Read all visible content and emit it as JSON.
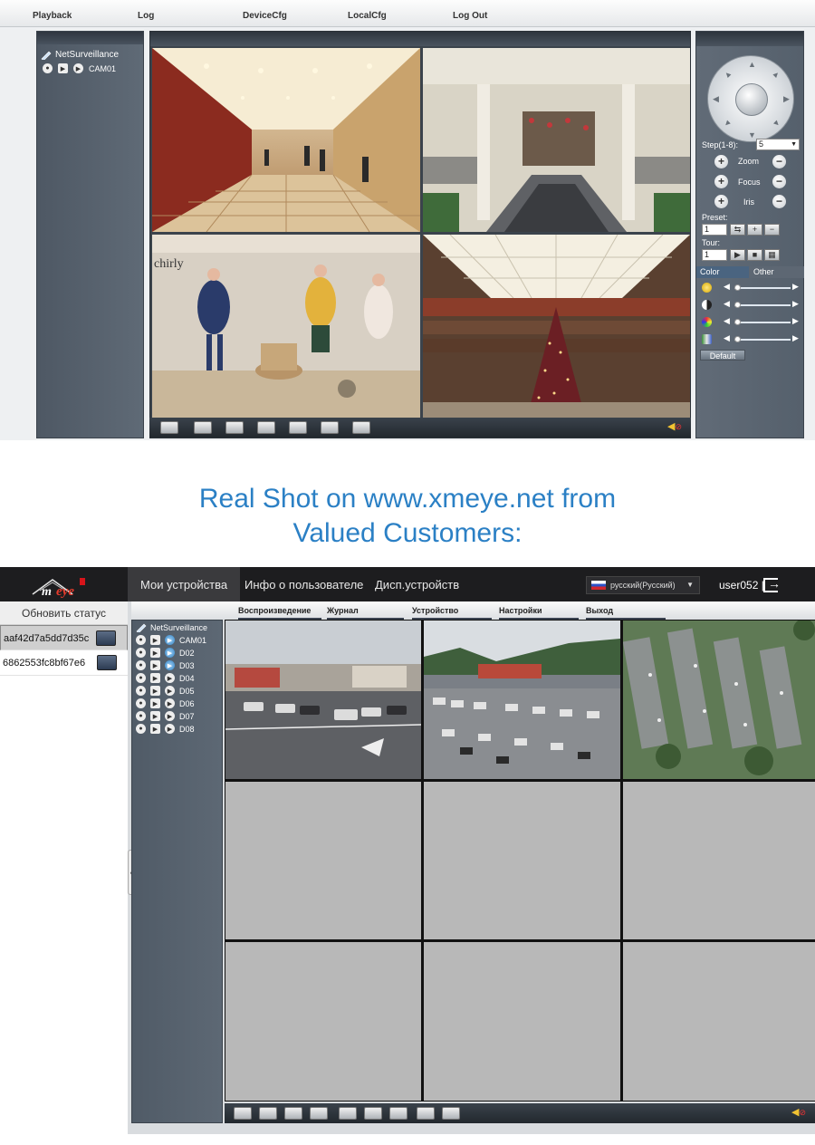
{
  "top": {
    "menu": [
      "Playback",
      "Log",
      "DeviceCfg",
      "LocalCfg",
      "Log Out"
    ],
    "tree": {
      "root": "NetSurveillance",
      "cameras": [
        "CAM01"
      ]
    },
    "ptz": {
      "step_label": "Step(1-8):",
      "step_value": "5",
      "zoom_label": "Zoom",
      "focus_label": "Focus",
      "iris_label": "Iris",
      "preset_label": "Preset:",
      "preset_value": "1",
      "tour_label": "Tour:",
      "tour_value": "1",
      "tabs": [
        "Color",
        "Other"
      ],
      "sliders": [
        {
          "icon": "brightness-icon",
          "level": 0.05
        },
        {
          "icon": "contrast-icon",
          "level": 0.05
        },
        {
          "icon": "saturation-icon",
          "level": 0.05
        },
        {
          "icon": "hue-icon",
          "level": 0.05
        }
      ],
      "default_label": "Default"
    }
  },
  "headline": {
    "line1": "Real Shot on www.xmeye.net from",
    "line2": "Valued Customers:"
  },
  "bottom": {
    "tabs": [
      "Мои устройства",
      "Инфо о пользователе",
      "Дисп.устройств"
    ],
    "language": "русский(Русский)",
    "user": "user052",
    "separator": "|",
    "refresh_label": "Обновить статус",
    "devices": [
      "aaf42d7a5dd7d35c",
      "6862553fc8bf67e6"
    ],
    "menu": [
      "Воспроизведение",
      "Журнал",
      "Устройство",
      "Настройки",
      "Выход"
    ],
    "tree": {
      "root": "NetSurveillance",
      "cameras": [
        "CAM01",
        "D02",
        "D03",
        "D04",
        "D05",
        "D06",
        "D07",
        "D08"
      ]
    },
    "collapse_glyph": "«"
  },
  "colors": {
    "headline": "#2b80c5",
    "panel": "#55606c",
    "header_dark": "#1d1d1f"
  }
}
